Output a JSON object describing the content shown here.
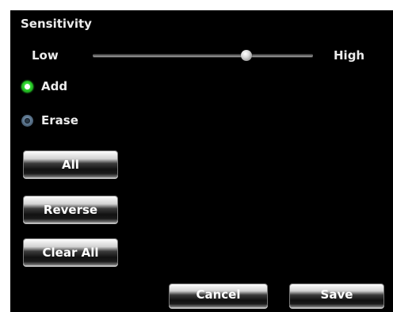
{
  "sensitivity": {
    "title": "Sensitivity",
    "low_label": "Low",
    "high_label": "High",
    "level": 0.7
  },
  "mode": {
    "options": [
      {
        "label": "Add",
        "selected": true
      },
      {
        "label": "Erase",
        "selected": false
      }
    ]
  },
  "actions": {
    "all_label": "All",
    "reverse_label": "Reverse",
    "clear_all_label": "Clear All"
  },
  "footer": {
    "cancel_label": "Cancel",
    "save_label": "Save"
  },
  "colors": {
    "panel_background": "#000000",
    "text": "#ececec",
    "radio_active": "#2ad12a",
    "radio_inactive": "#5d7790"
  }
}
